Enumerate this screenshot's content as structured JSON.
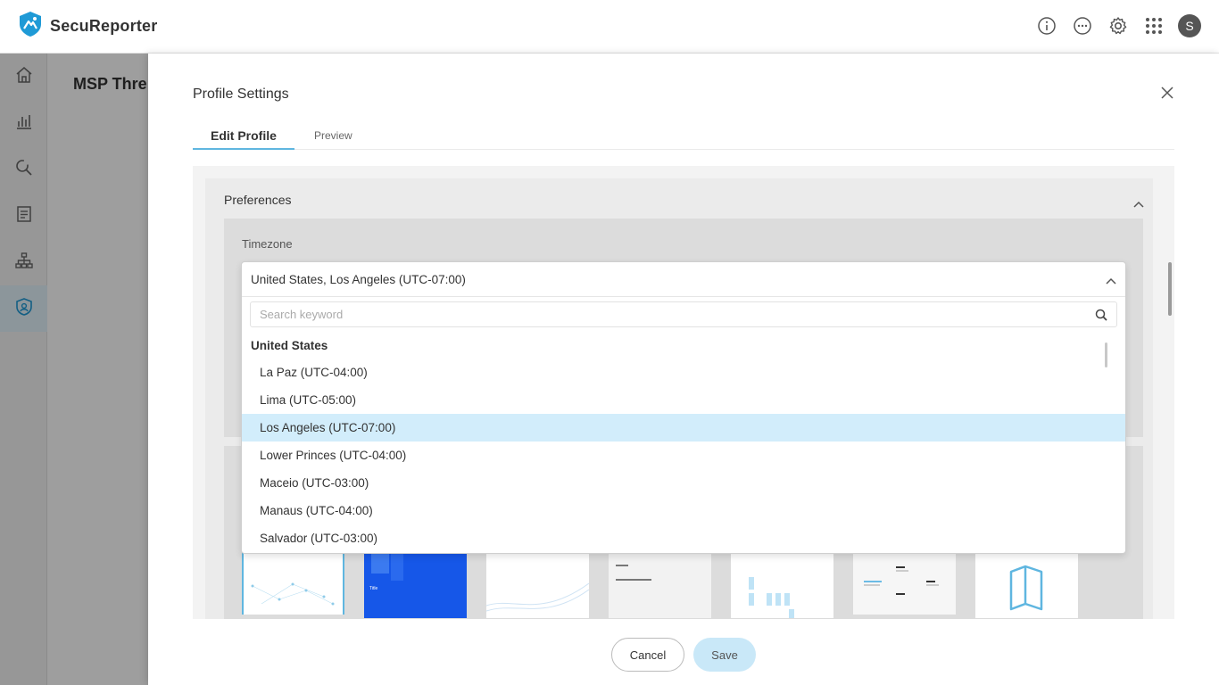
{
  "app": {
    "name": "SecuReporter",
    "brand_color": "#1f9ad6",
    "user_initial": "S"
  },
  "topbar_icons": [
    "info-icon",
    "more-icon",
    "gear-icon",
    "apps-grid-icon"
  ],
  "sidenav": [
    {
      "name": "home-icon",
      "active": false
    },
    {
      "name": "analyzer-icon",
      "active": false
    },
    {
      "name": "search-icon",
      "active": false
    },
    {
      "name": "report-icon",
      "active": false
    },
    {
      "name": "network-icon",
      "active": false
    },
    {
      "name": "shield-icon",
      "active": true
    }
  ],
  "page": {
    "title": "MSP Thre"
  },
  "drawer": {
    "title": "Profile Settings",
    "tabs": [
      "Edit Profile",
      "Preview"
    ],
    "active_tab": "Edit Profile",
    "section_title": "Preferences",
    "timezone_label": "Timezone",
    "thumbnail_title": "Title",
    "cancel_label": "Cancel",
    "save_label": "Save"
  },
  "dropdown": {
    "selected_value": "United States, Los Angeles (UTC-07:00)",
    "search_placeholder": "Search keyword",
    "group_label": "United States",
    "options": [
      "La Paz (UTC-04:00)",
      "Lima (UTC-05:00)",
      "Los Angeles (UTC-07:00)",
      "Lower Princes (UTC-04:00)",
      "Maceio (UTC-03:00)",
      "Manaus (UTC-04:00)",
      "Salvador (UTC-03:00)"
    ],
    "selected_option_index": 2,
    "highlight_color": "#d2edfb"
  }
}
